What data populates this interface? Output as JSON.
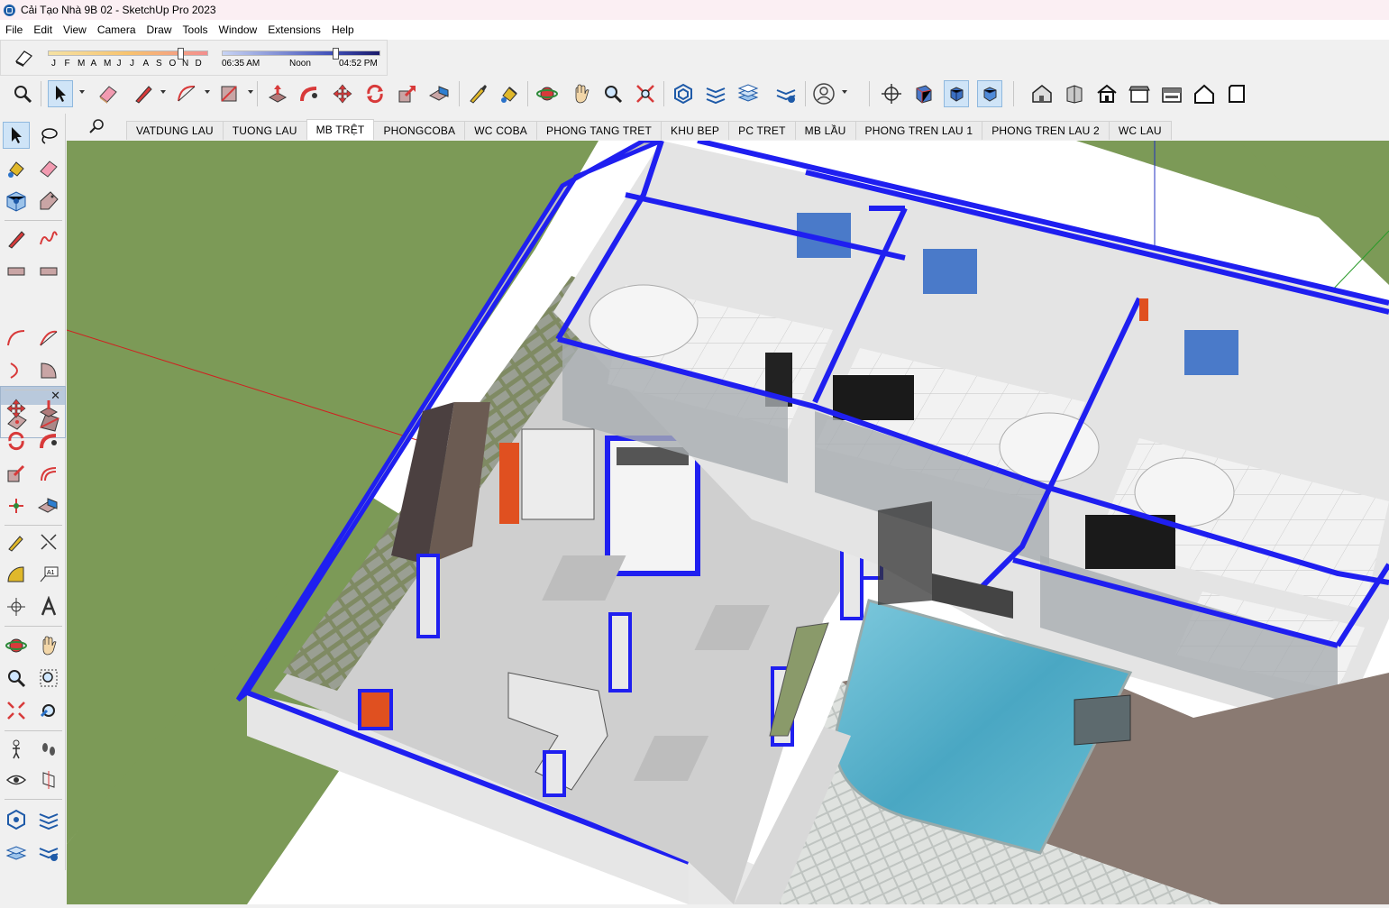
{
  "window": {
    "title": "Cải Tạo Nhà 9B 02 - SketchUp Pro 2023"
  },
  "menu": [
    "File",
    "Edit",
    "View",
    "Camera",
    "Draw",
    "Tools",
    "Window",
    "Extensions",
    "Help"
  ],
  "shadows": {
    "months": [
      "J",
      "F",
      "M",
      "A",
      "M",
      "J",
      "J",
      "A",
      "S",
      "O",
      "N",
      "D"
    ],
    "month_value_fraction": 0.83,
    "time_start": "06:35 AM",
    "time_noon": "Noon",
    "time_end": "04:52 PM",
    "time_value_fraction": 0.72
  },
  "toolbar_icons": [
    "zoom-extents-icon",
    "select-icon",
    "eraser-icon",
    "pencil-icon",
    "arc-icon",
    "shape-icon",
    "push-pull-icon",
    "follow-me-icon",
    "move-icon",
    "rotate-icon",
    "scale-icon",
    "offset-icon",
    "tape-measure-icon",
    "paint-bucket-icon",
    "orbit-icon",
    "pan-icon",
    "zoom-icon",
    "zoom-window-icon",
    "sandbox-from-contours-icon",
    "sandbox-from-scratch-icon",
    "smoove-icon",
    "stamp-icon",
    "account-icon",
    "section-plane-icon",
    "iso-view-icon",
    "front-view-icon",
    "right-view-icon",
    "top-view-icon",
    "xray-icon",
    "wireframe-icon",
    "hidden-line-icon",
    "shaded-icon",
    "shaded-texture-icon",
    "monochrome-icon"
  ],
  "scenes": {
    "tabs": [
      "VATDUNG LAU",
      "TUONG LAU",
      "MB TRỆT",
      "PHONGCOBA",
      "WC COBA",
      "PHONG TANG TRET",
      "KHU BEP",
      "PC TRET",
      "MB LẦU",
      "PHONG TREN LAU 1",
      "PHONG TREN LAU 2",
      "WC LAU"
    ],
    "active": "MB TRỆT"
  },
  "colors": {
    "wall_highlight": "#1f1ff0",
    "grass": "#7c9a57",
    "pool": "#5fb6cf",
    "floor": "#cfcfcf",
    "deck": "#8a7a72"
  }
}
